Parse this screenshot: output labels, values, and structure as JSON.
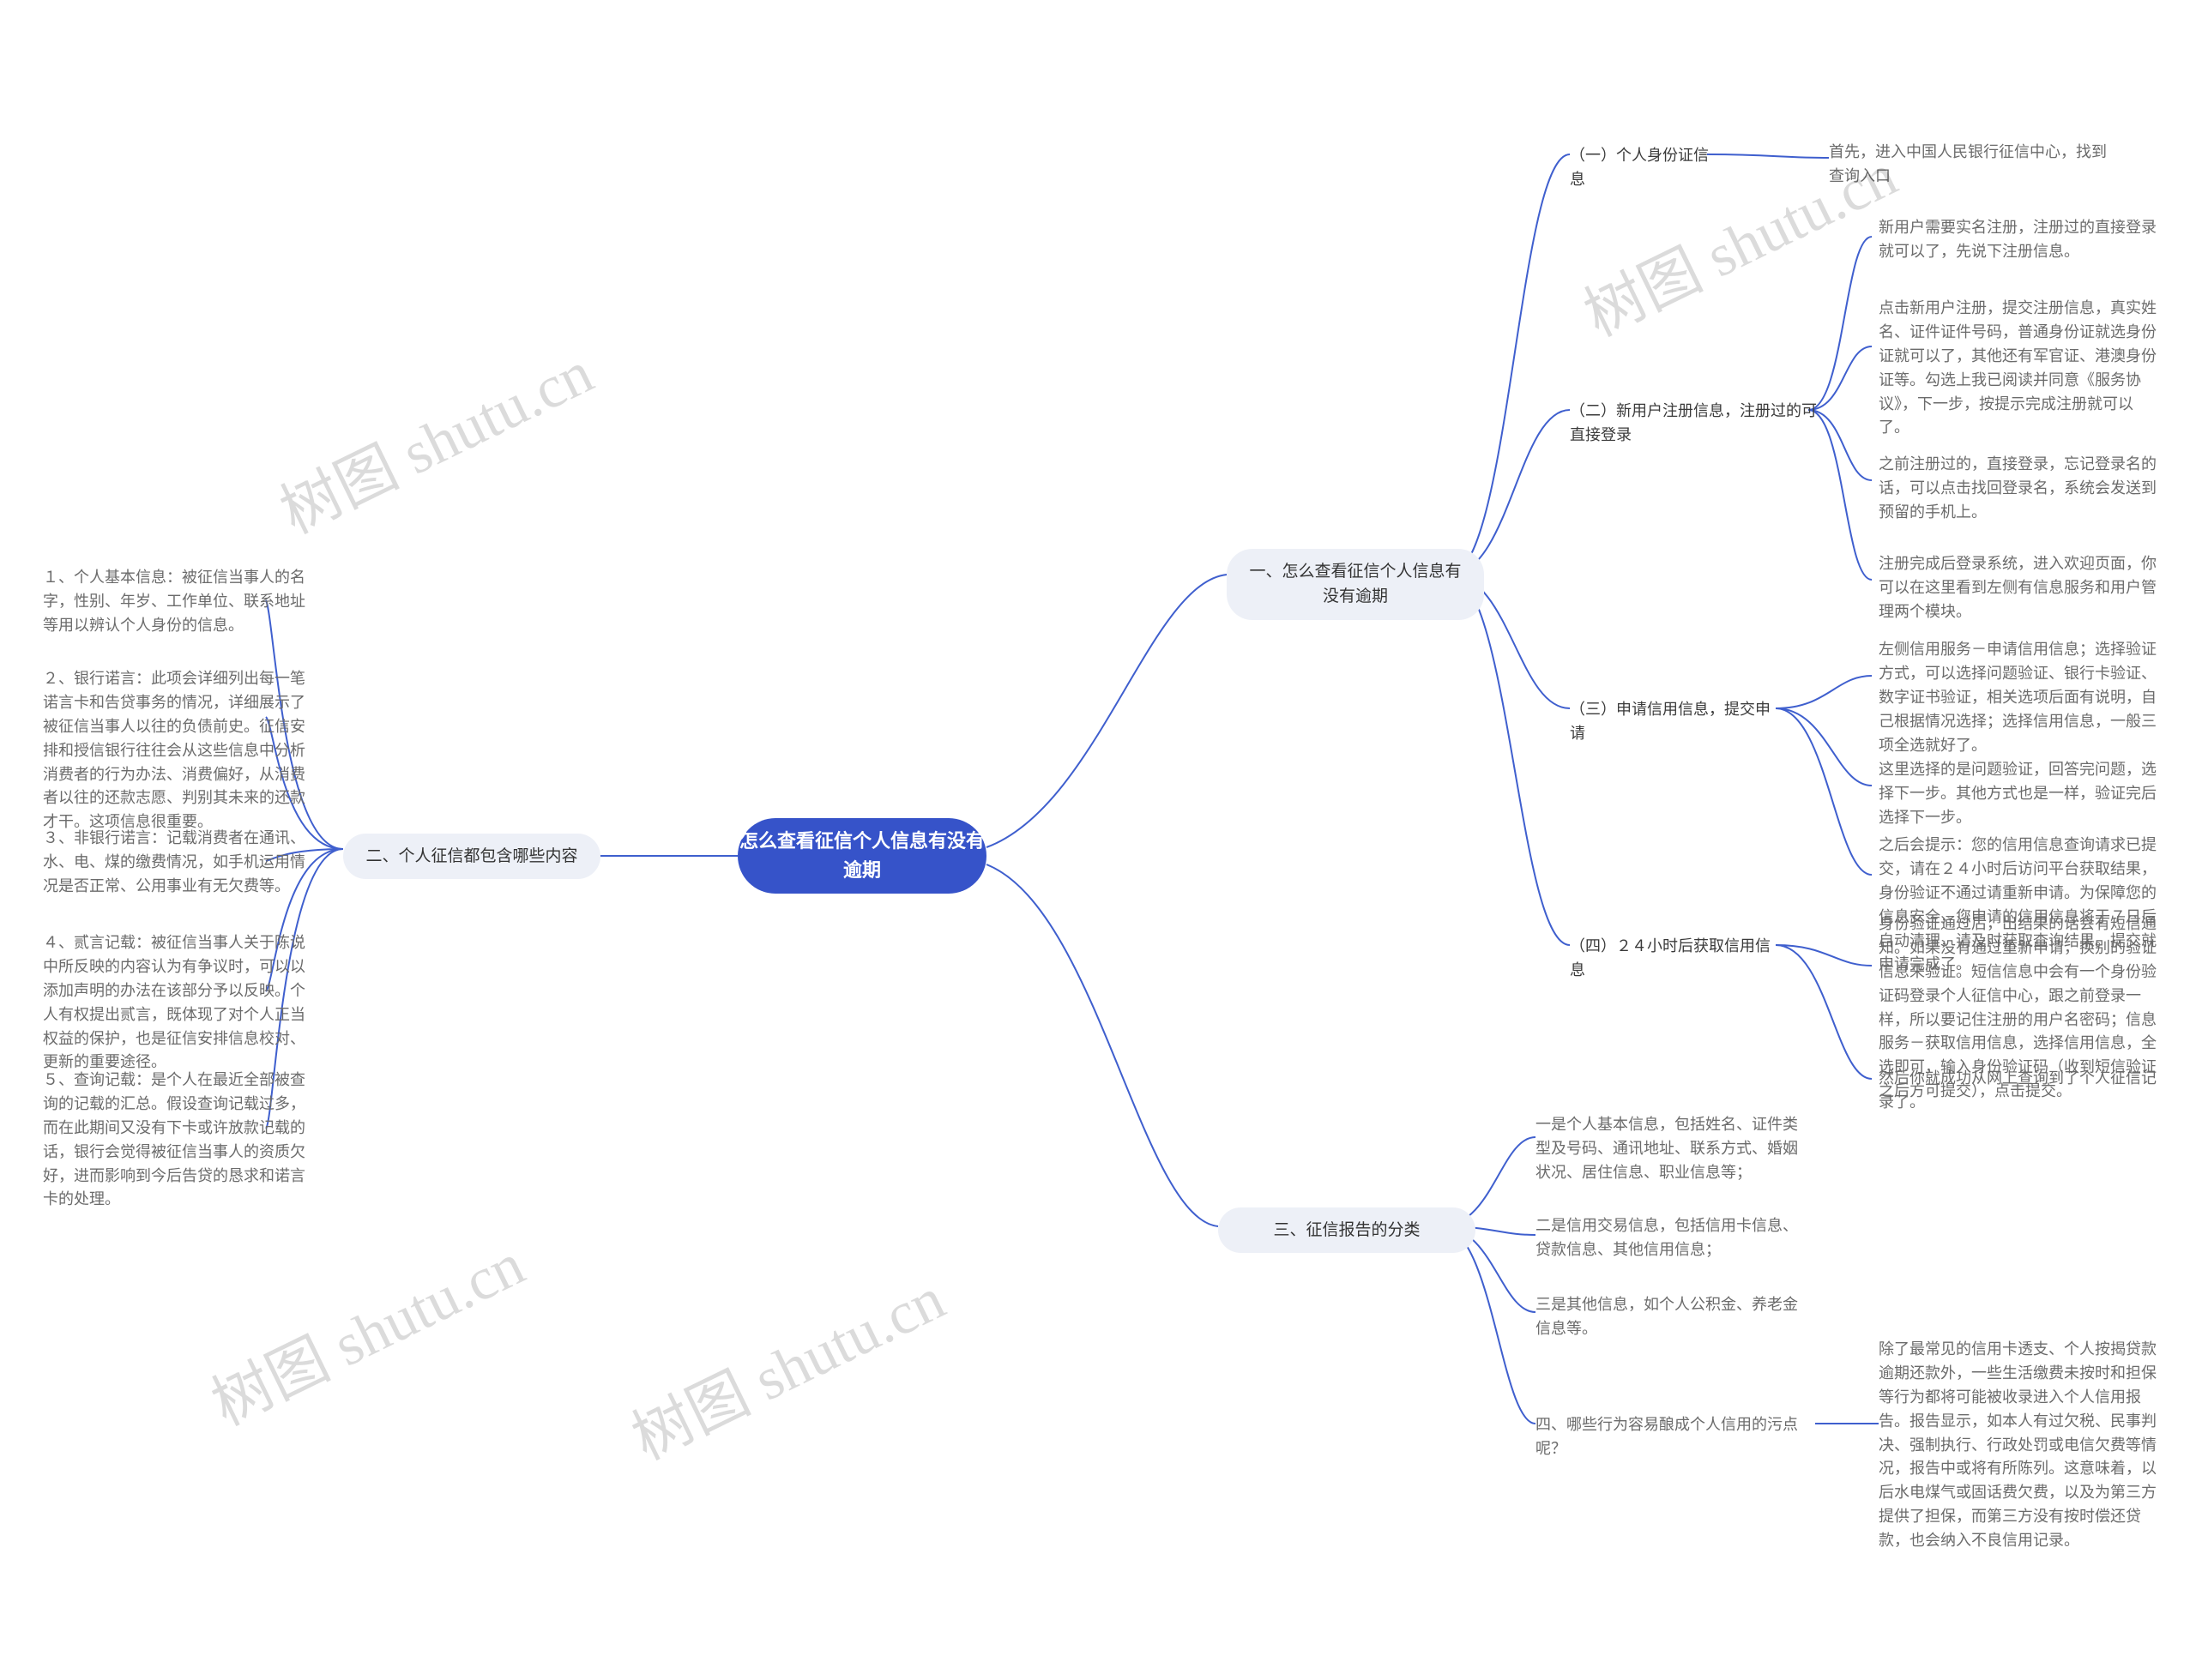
{
  "center": "怎么查看征信个人信息有没有逾期",
  "left": {
    "branch": "二、个人征信都包含哪些内容",
    "items": [
      "１、个人基本信息：被征信当事人的名字，性别、年岁、工作单位、联系地址等用以辨认个人身份的信息。",
      "２、银行诺言：此项会详细列出每一笔诺言卡和告贷事务的情况，详细展示了被征信当事人以往的负债前史。征信安排和授信银行往往会从这些信息中分析消费者的行为办法、消费偏好，从消费者以往的还款志愿、判别其未来的还款才干。这项信息很重要。",
      "３、非银行诺言：记载消费者在通讯、水、电、煤的缴费情况，如手机运用情况是否正常、公用事业有无欠费等。",
      "４、贰言记载：被征信当事人关于陈说中所反映的内容认为有争议时，可以以添加声明的办法在该部分予以反映。个人有权提出贰言，既体现了对个人正当权益的保护，也是征信安排信息校对、更新的重要途径。",
      "５、查询记载：是个人在最近全部被查询的记载的汇总。假设查询记载过多，而在此期间又没有下卡或许放款记载的话，银行会觉得被征信当事人的资质欠好，进而影响到今后告贷的恳求和诺言卡的处理。"
    ]
  },
  "right1": {
    "branch": "一、怎么查看征信个人信息有没有逾期",
    "subs": [
      {
        "title": "（一）个人身份证信息",
        "leaves": [
          "首先，进入中国人民银行征信中心，找到查询入口"
        ]
      },
      {
        "title": "（二）新用户注册信息，注册过的可直接登录",
        "leaves": [
          "新用户需要实名注册，注册过的直接登录就可以了，先说下注册信息。",
          "点击新用户注册，提交注册信息，真实姓名、证件证件号码，普通身份证就选身份证就可以了，其他还有军官证、港澳身份证等。勾选上我已阅读并同意《服务协议》，下一步，按提示完成注册就可以了。",
          "之前注册过的，直接登录，忘记登录名的话，可以点击找回登录名，系统会发送到预留的手机上。",
          "注册完成后登录系统，进入欢迎页面，你可以在这里看到左侧有信息服务和用户管理两个模块。"
        ]
      },
      {
        "title": "（三）申请信用信息，提交申请",
        "leaves": [
          "左侧信用服务－申请信用信息；选择验证方式，可以选择问题验证、银行卡验证、数字证书验证，相关选项后面有说明，自己根据情况选择；选择信用信息，一般三项全选就好了。",
          "这里选择的是问题验证，回答完问题，选择下一步。其他方式也是一样，验证完后选择下一步。",
          "之后会提示：您的信用信息查询请求已提交，请在２４小时后访问平台获取结果，身份验证不通过请重新申请。为保障您的信息安全，您申请的信用信息将于７日后自动清理，请及时获取查询结果。提交就申请完成了。"
        ]
      },
      {
        "title": "（四）２４小时后获取信用信息",
        "leaves": [
          "身份验证通过后，出结果的话会有短信通知。如果没有通过重新申请，换别的验证信息来验证。短信信息中会有一个身份验证码登录个人征信中心，跟之前登录一样，所以要记住注册的用户名密码；信息服务－获取信用信息，选择信用信息，全选即可，输入身份验证码（收到短信验证之后方可提交），点击提交。",
          "然后你就成功从网上查询到了个人征信记录了。"
        ]
      }
    ]
  },
  "right3": {
    "branch": "三、征信报告的分类",
    "items": [
      "一是个人基本信息，包括姓名、证件类型及号码、通讯地址、联系方式、婚姻状况、居住信息、职业信息等；",
      "二是信用交易信息，包括信用卡信息、贷款信息、其他信用信息；",
      "三是其他信息，如个人公积金、养老金信息等。",
      "四、哪些行为容易酿成个人信用的污点呢？"
    ],
    "tail": "除了最常见的信用卡透支、个人按揭贷款逾期还款外，一些生活缴费未按时和担保等行为都将可能被收录进入个人信用报告。报告显示，如本人有过欠税、民事判决、强制执行、行政处罚或电信欠费等情况，报告中或将有所陈列。这意味着，以后水电煤气或固话费欠费，以及为第三方提供了担保，而第三方没有按时偿还贷款，也会纳入不良信用记录。"
  },
  "watermarks": [
    "树图 shutu.cn",
    "树图 shutu.cn",
    "树图 shutu.cn",
    "树图 shutu.cn"
  ]
}
